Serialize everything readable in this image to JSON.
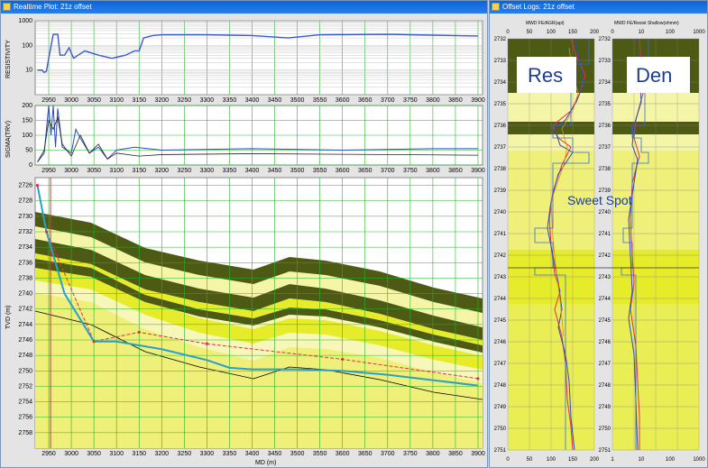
{
  "left_window": {
    "title": "Realtime Plot: 21z offset"
  },
  "right_window": {
    "title": "Offset Logs: 21z offset"
  },
  "resistivity_panel": {
    "ylabel": "RESISTIVITY",
    "y_ticks": [
      "1000",
      "100",
      "10"
    ]
  },
  "sigma_panel": {
    "ylabel": "SIGMA(TRV)",
    "y_ticks": [
      "200",
      "150",
      "100",
      "50",
      "0"
    ]
  },
  "tvd_panel": {
    "ylabel": "TVD (m)",
    "xlabel": "MD (m)",
    "y_ticks": [
      "2726",
      "2728",
      "2730",
      "2732",
      "2734",
      "2736",
      "2738",
      "2740",
      "2742",
      "2744",
      "2746",
      "2748",
      "2750",
      "2752",
      "2754",
      "2756",
      "2758"
    ]
  },
  "md_ticks": [
    "2950",
    "3000",
    "3050",
    "3100",
    "3150",
    "3200",
    "3250",
    "3300",
    "3350",
    "3400",
    "3450",
    "3500",
    "3550",
    "3600",
    "3650",
    "3700",
    "3750",
    "3800",
    "3850",
    "3900"
  ],
  "offset_tracks": {
    "res_header": "MWD FE/AGR(api)",
    "den_header": "MWD FE/Resist Shallow(ohmm)",
    "res_top_ticks": [
      "0",
      "50",
      "100",
      "150",
      "200"
    ],
    "res_bottom_ticks": [
      "0",
      "50",
      "100",
      "150",
      "200"
    ],
    "den_top_ticks": [
      "0",
      "10",
      "100",
      "1000"
    ],
    "den_bottom_ticks": [
      "1",
      "10",
      "100",
      "1000"
    ],
    "depth_ticks": [
      "2732",
      "2733",
      "2734",
      "2735",
      "2736",
      "2737",
      "2738",
      "2739",
      "2740",
      "2741",
      "2742",
      "2743",
      "2744",
      "2745",
      "2746",
      "2747",
      "2748",
      "2749",
      "2750",
      "2751"
    ],
    "res_label": "Res",
    "den_label": "Den",
    "sweet_spot": "Sweet Spot"
  },
  "colors": {
    "dark_olive": "#4d5a14",
    "yellow": "#e7ec2a",
    "pale_yellow": "#eef07a",
    "green_grid": "#27b22a",
    "well_path": "#2aa0c8",
    "planned_path": "#e0304a",
    "curve_blue": "#2c4bbf"
  },
  "chart_data": [
    {
      "type": "line",
      "name_of_panel": "resistivity",
      "x": [
        2925,
        2935,
        2940,
        2945,
        2950,
        2960,
        2970,
        2975,
        2985,
        2995,
        3005,
        3015,
        3030,
        3060,
        3090,
        3120,
        3140,
        3150,
        3160,
        3180,
        3200,
        3300,
        3400,
        3480,
        3550,
        3700,
        3800,
        3900
      ],
      "y": [
        10,
        10,
        8,
        9,
        30,
        280,
        280,
        40,
        40,
        80,
        30,
        40,
        60,
        40,
        30,
        40,
        60,
        60,
        200,
        250,
        270,
        270,
        250,
        200,
        270,
        280,
        260,
        240
      ],
      "ylim": [
        1,
        1000
      ],
      "yscale": "log"
    },
    {
      "type": "line",
      "name_of_panel": "sigma",
      "series": [
        {
          "x": [
            2925,
            2940,
            2950,
            2955,
            2960,
            2965,
            2970,
            2980,
            3000,
            3010,
            3020,
            3040,
            3060,
            3080,
            3100,
            3140,
            3200,
            3400,
            3600,
            3800,
            3900
          ],
          "y": [
            10,
            40,
            200,
            100,
            200,
            60,
            190,
            60,
            40,
            120,
            90,
            40,
            60,
            20,
            50,
            60,
            50,
            55,
            50,
            55,
            55
          ]
        },
        {
          "x": [
            2925,
            2940,
            2950,
            2960,
            2970,
            2980,
            3000,
            3020,
            3040,
            3060,
            3080,
            3100,
            3150,
            3200,
            3400,
            3600,
            3800,
            3900
          ],
          "y": [
            10,
            50,
            150,
            120,
            160,
            70,
            30,
            100,
            40,
            70,
            20,
            40,
            30,
            35,
            38,
            36,
            34,
            33
          ]
        }
      ],
      "ylim": [
        0,
        200
      ]
    },
    {
      "type": "line",
      "name_of_panel": "tvd",
      "series": [
        {
          "x": [
            2925,
            2945,
            2985,
            3050,
            3100,
            3200,
            3300,
            3350,
            3400,
            3500,
            3600,
            3700,
            3800,
            3900
          ],
          "y": [
            2726,
            2732,
            2740,
            2746.2,
            2746.2,
            2747.2,
            2748.6,
            2749.6,
            2749.8,
            2749.8,
            2750,
            2750.5,
            2751.2,
            2751.9
          ]
        },
        {
          "x": [
            2925,
            2945,
            3050,
            3150,
            3300,
            3600,
            3900
          ],
          "y": [
            2726,
            2732,
            2746.2,
            2745,
            2746.5,
            2748.5,
            2751
          ]
        }
      ],
      "ylim": [
        2725,
        2760
      ],
      "xlim": [
        2920,
        3910
      ]
    }
  ]
}
